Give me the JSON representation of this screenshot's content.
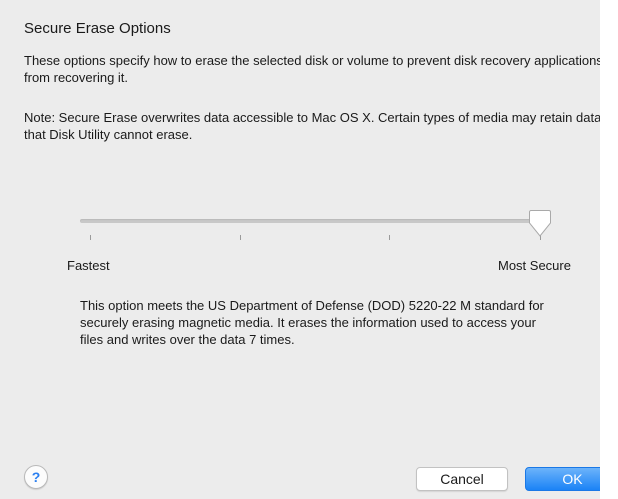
{
  "dialog": {
    "title": "Secure Erase Options",
    "description": "These options specify how to erase the selected disk or volume to prevent disk recovery applications from recovering it.",
    "note": "Note: Secure Erase overwrites data accessible to Mac OS X.  Certain types of media may retain data that Disk Utility cannot erase."
  },
  "slider": {
    "min_label": "Fastest",
    "max_label": "Most Secure",
    "steps": 4,
    "selected_step": 4,
    "level_fraction": 1.0
  },
  "info": {
    "text": "This option meets the US Department of Defense (DOD) 5220-22 M standard for securely erasing magnetic media. It erases the information used to access your files and writes over the data 7 times."
  },
  "buttons": {
    "help_label": "?",
    "cancel_label": "Cancel",
    "ok_label": "OK"
  },
  "colors": {
    "accent": "#1b83f6",
    "background": "#ececec"
  }
}
